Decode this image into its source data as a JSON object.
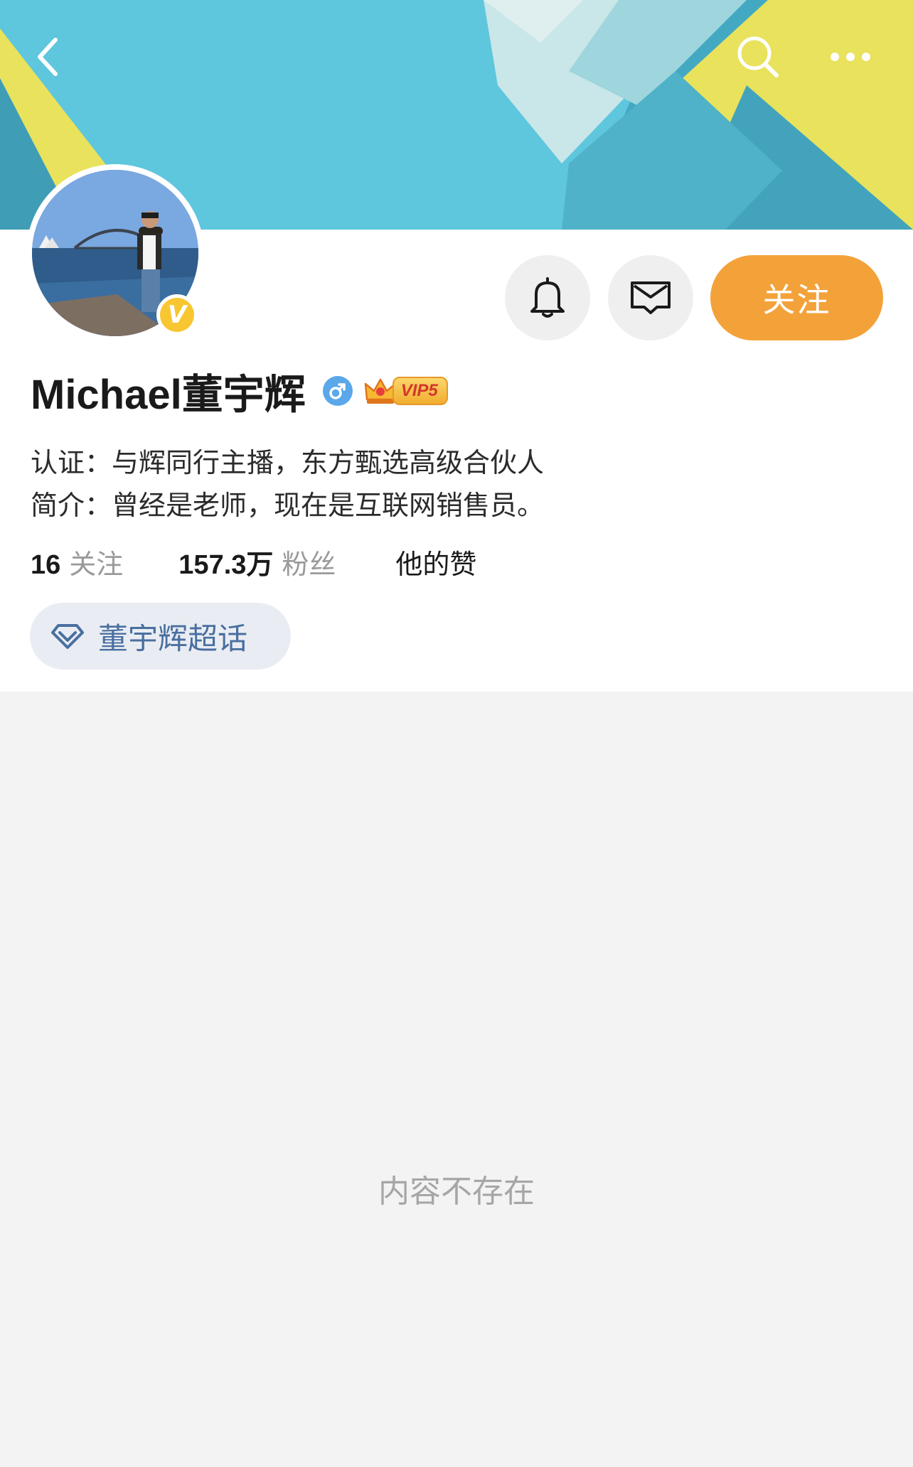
{
  "profile": {
    "name": "Michael董宇辉",
    "vip_label": "VIP5",
    "verified_badge": "V",
    "certification": "认证：与辉同行主播，东方甄选高级合伙人",
    "intro": "简介：曾经是老师，现在是互联网销售员。"
  },
  "actions": {
    "follow_label": "关注"
  },
  "stats": {
    "following_count": "16",
    "following_label": "关注",
    "followers_count": "157.3万",
    "followers_label": "粉丝",
    "likes_label": "他的赞"
  },
  "supertopic": {
    "label": "董宇辉超话"
  },
  "feed": {
    "empty_text": "内容不存在"
  },
  "icons": {
    "back": "chevron-left-icon",
    "search": "search-icon",
    "more": "more-dots-icon",
    "notify": "bell-icon",
    "message": "mail-icon",
    "gender": "male-icon",
    "supertopic": "diamond-icon"
  },
  "colors": {
    "follow_button": "#f3a23a",
    "verified_badge": "#f8c630",
    "gender_badge": "#5aa7ea",
    "supertopic_text": "#4a6fa0",
    "banner_teal": "#4db8d0",
    "banner_yellow": "#e8e25c"
  }
}
